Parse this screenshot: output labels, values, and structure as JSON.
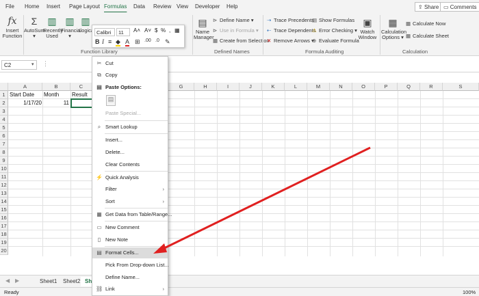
{
  "tabs": [
    "File",
    "Home",
    "Insert",
    "Page Layout",
    "Formulas",
    "Data",
    "Review",
    "View",
    "Developer",
    "Help"
  ],
  "active_tab": "Formulas",
  "top_buttons": {
    "share": "Share",
    "comments": "Comments"
  },
  "ribbon": {
    "insert_function": {
      "icon": "fx",
      "label1": "Insert",
      "label2": "Function"
    },
    "autosum": {
      "icon": "Σ",
      "label": "AutoSum"
    },
    "recently_used": {
      "label1": "Recently",
      "label2": "Used"
    },
    "financial": {
      "label": "Financial"
    },
    "logical": {
      "label": "Logica"
    },
    "function_library_group": "Function Library",
    "name_manager": {
      "label1": "Name",
      "label2": "Manager"
    },
    "define_name": "Define Name",
    "use_in_formula": "Use in Formula",
    "create_from_selection": "Create from Selection",
    "defined_names_group": "Defined Names",
    "trace_precedents": "Trace Precedents",
    "trace_dependents": "Trace Dependents",
    "remove_arrows": "Remove Arrows",
    "show_formulas": "Show Formulas",
    "error_checking": "Error Checking",
    "evaluate_formula": "Evaluate Formula",
    "watch_window": {
      "label1": "Watch",
      "label2": "Window"
    },
    "formula_auditing_group": "Formula Auditing",
    "calc_options": {
      "label1": "Calculation",
      "label2": "Options"
    },
    "calculate_now": "Calculate Now",
    "calculate_sheet": "Calculate Sheet",
    "calculation_group": "Calculation"
  },
  "mini_toolbar": {
    "font": "Calibri",
    "size": "11"
  },
  "name_box": "C2",
  "columns": [
    "A",
    "B",
    "C",
    "D",
    "E",
    "F",
    "G",
    "H",
    "I",
    "J",
    "K",
    "L",
    "M",
    "N",
    "O",
    "P",
    "Q",
    "R",
    "S"
  ],
  "rows": [
    "1",
    "2",
    "3",
    "4",
    "5",
    "6",
    "7",
    "8",
    "9",
    "10",
    "11",
    "12",
    "13",
    "14",
    "15",
    "16",
    "17",
    "18",
    "19",
    "20"
  ],
  "cells": {
    "A1": "Start Date",
    "B1": "Month",
    "C1": "Result",
    "A2": "1/17/20",
    "B2": "11"
  },
  "context_menu": {
    "cut": "Cut",
    "copy": "Copy",
    "paste_options": "Paste Options:",
    "paste_special": "Paste Special...",
    "smart_lookup": "Smart Lookup",
    "insert": "Insert...",
    "delete": "Delete...",
    "clear_contents": "Clear Contents",
    "quick_analysis": "Quick Analysis",
    "filter": "Filter",
    "sort": "Sort",
    "get_data": "Get Data from Table/Range...",
    "new_comment": "New Comment",
    "new_note": "New Note",
    "format_cells": "Format Cells...",
    "pick_dropdown": "Pick From Drop-down List...",
    "define_name": "Define Name...",
    "link": "Link"
  },
  "sheet_tabs": [
    "Sheet1",
    "Sheet2",
    "Shee"
  ],
  "status": {
    "left": "Ready",
    "zoom": "100%"
  },
  "accent_color": "#217346",
  "arrow_color": "#e02020"
}
